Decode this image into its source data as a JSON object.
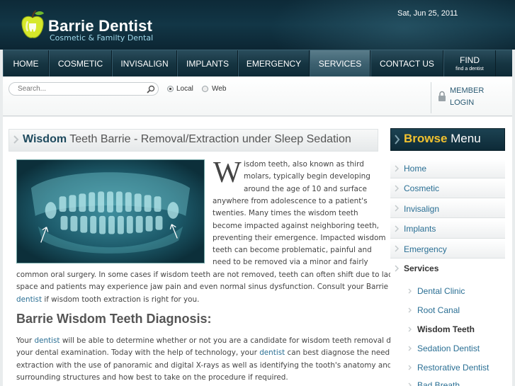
{
  "header": {
    "site_title": "Barrie Dentist",
    "tagline": "Cosmetic & Familty Dental",
    "date": "Sat, Jun 25, 2011",
    "logo_icon": "apple-tooth-icon"
  },
  "nav": {
    "items": [
      {
        "label": "HOME"
      },
      {
        "label": "COSMETIC"
      },
      {
        "label": "INVISALIGN"
      },
      {
        "label": "IMPLANTS"
      },
      {
        "label": "EMERGENCY"
      },
      {
        "label": "SERVICES",
        "active": true
      },
      {
        "label": "CONTACT US"
      }
    ],
    "find": {
      "label": "FIND",
      "sublabel": "find a dentist"
    }
  },
  "search": {
    "placeholder": "Search...",
    "options": [
      {
        "label": "Local",
        "selected": true
      },
      {
        "label": "Web",
        "selected": false
      }
    ],
    "member": {
      "line1": "MEMBER",
      "line2": "LOGIN"
    }
  },
  "article": {
    "title_bold": "Wisdom",
    "title_rest": " Teeth Barrie - Removal/Extraction under Sleep Sedation",
    "dropcap": "W",
    "intro_lines": [
      "isdom teeth, also known as third",
      "molars, typically begin developing",
      "around the age of 10 and surface",
      "anywhere from adolescence to a patient's",
      "twenties.  Many times the wisdom teeth",
      "become impacted against neighboring teeth,",
      "preventing their emergence. Impacted wisdom",
      "teeth can become problematic, painful and",
      "need to be removed via a minor and fairly"
    ],
    "full_lines": [
      "common oral surgery. In some cases if wisdom teeth are not removed, teeth can often shift due to lack of",
      "space and patients may experience jaw pain and even normal sinus dysfunction. Consult your Barrie"
    ],
    "last_line_link": "dentist",
    "last_line_rest": " if wisdom tooth extraction is right for you.",
    "section_heading": "Barrie Wisdom Teeth Diagnosis:",
    "section_lines": [
      {
        "pre": "Your ",
        "link": "dentist",
        "post": " will be able to determine whether or not you are a candidate for wisdom teeth removal during"
      },
      {
        "pre": "your dental examination. Today with the help of technology, your ",
        "link": "dentist",
        "post": " can best diagnose the need for"
      },
      {
        "pre": "extraction with the use of panoramic and digital X-rays as well as identifying the tooth's anatomy and its",
        "link": "",
        "post": ""
      },
      {
        "pre": "surrounding structures and how best to take on the procedure if required.",
        "link": "",
        "post": ""
      }
    ]
  },
  "sidebar": {
    "heading_bold": "Browse",
    "heading_rest": " Menu",
    "items": [
      {
        "label": "Home"
      },
      {
        "label": "Cosmetic"
      },
      {
        "label": "Invisalign"
      },
      {
        "label": "Implants"
      },
      {
        "label": "Emergency"
      },
      {
        "label": "Services",
        "expanded": true
      }
    ],
    "subitems": [
      {
        "label": "Dental Clinic"
      },
      {
        "label": "Root Canal"
      },
      {
        "label": "Wisdom Teeth",
        "current": true
      },
      {
        "label": "Sedation Dentist"
      },
      {
        "label": "Restorative Dentist"
      },
      {
        "label": "Bad Breath"
      }
    ]
  }
}
